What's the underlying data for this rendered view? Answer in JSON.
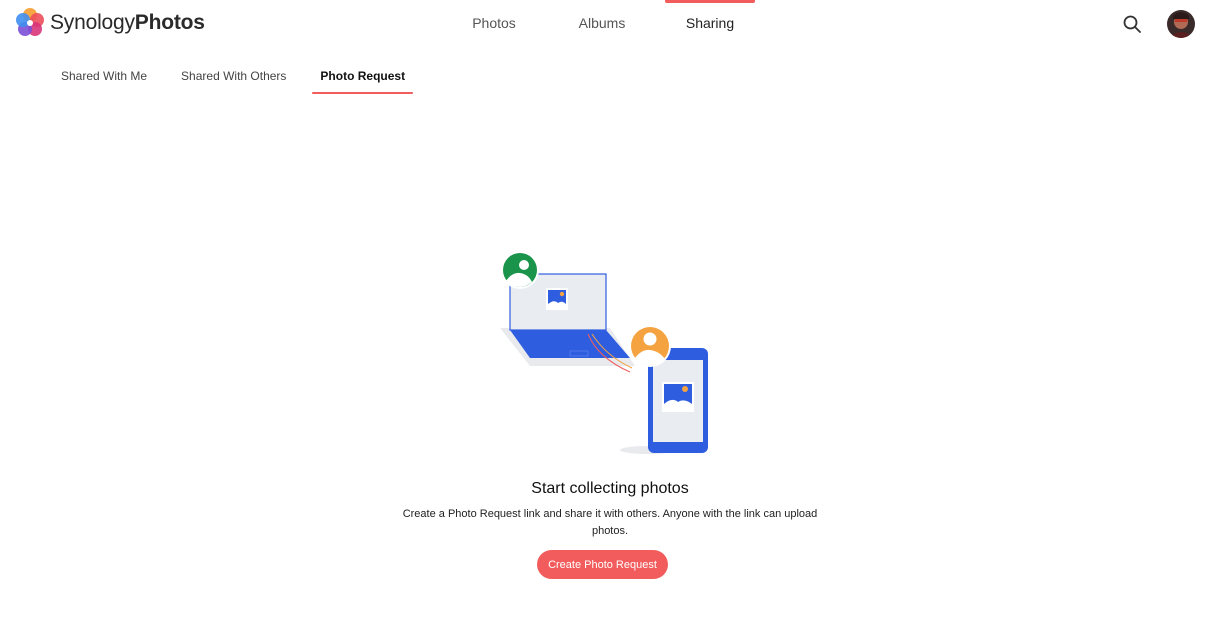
{
  "app": {
    "brand_light": "Synology",
    "brand_bold": "Photos"
  },
  "main_nav": {
    "tabs": [
      {
        "label": "Photos",
        "active": false
      },
      {
        "label": "Albums",
        "active": false
      },
      {
        "label": "Sharing",
        "active": true
      }
    ]
  },
  "sub_nav": {
    "tabs": [
      {
        "label": "Shared With Me",
        "active": false
      },
      {
        "label": "Shared With Others",
        "active": false
      },
      {
        "label": "Photo Request",
        "active": true
      }
    ]
  },
  "empty_state": {
    "title": "Start collecting photos",
    "description": "Create a Photo Request link and share it with others. Anyone with the link can upload photos.",
    "button_label": "Create Photo Request"
  },
  "icons": {
    "search": "search-icon",
    "avatar": "avatar"
  },
  "colors": {
    "accent": "#f25c5c",
    "illustration_blue": "#2f5de0",
    "illustration_green": "#19944a",
    "illustration_orange": "#f5a340"
  }
}
